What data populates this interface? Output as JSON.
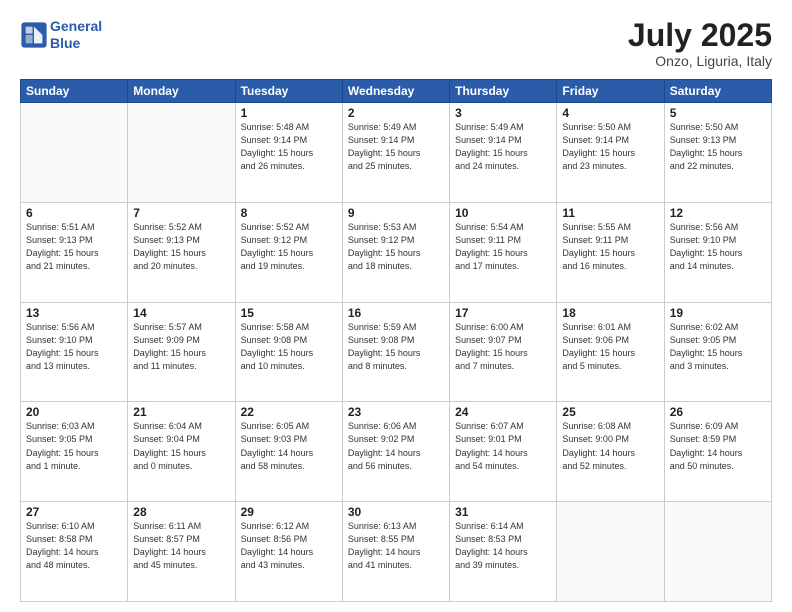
{
  "header": {
    "logo_line1": "General",
    "logo_line2": "Blue",
    "month": "July 2025",
    "location": "Onzo, Liguria, Italy"
  },
  "weekdays": [
    "Sunday",
    "Monday",
    "Tuesday",
    "Wednesday",
    "Thursday",
    "Friday",
    "Saturday"
  ],
  "weeks": [
    [
      {
        "day": "",
        "info": ""
      },
      {
        "day": "",
        "info": ""
      },
      {
        "day": "1",
        "info": "Sunrise: 5:48 AM\nSunset: 9:14 PM\nDaylight: 15 hours\nand 26 minutes."
      },
      {
        "day": "2",
        "info": "Sunrise: 5:49 AM\nSunset: 9:14 PM\nDaylight: 15 hours\nand 25 minutes."
      },
      {
        "day": "3",
        "info": "Sunrise: 5:49 AM\nSunset: 9:14 PM\nDaylight: 15 hours\nand 24 minutes."
      },
      {
        "day": "4",
        "info": "Sunrise: 5:50 AM\nSunset: 9:14 PM\nDaylight: 15 hours\nand 23 minutes."
      },
      {
        "day": "5",
        "info": "Sunrise: 5:50 AM\nSunset: 9:13 PM\nDaylight: 15 hours\nand 22 minutes."
      }
    ],
    [
      {
        "day": "6",
        "info": "Sunrise: 5:51 AM\nSunset: 9:13 PM\nDaylight: 15 hours\nand 21 minutes."
      },
      {
        "day": "7",
        "info": "Sunrise: 5:52 AM\nSunset: 9:13 PM\nDaylight: 15 hours\nand 20 minutes."
      },
      {
        "day": "8",
        "info": "Sunrise: 5:52 AM\nSunset: 9:12 PM\nDaylight: 15 hours\nand 19 minutes."
      },
      {
        "day": "9",
        "info": "Sunrise: 5:53 AM\nSunset: 9:12 PM\nDaylight: 15 hours\nand 18 minutes."
      },
      {
        "day": "10",
        "info": "Sunrise: 5:54 AM\nSunset: 9:11 PM\nDaylight: 15 hours\nand 17 minutes."
      },
      {
        "day": "11",
        "info": "Sunrise: 5:55 AM\nSunset: 9:11 PM\nDaylight: 15 hours\nand 16 minutes."
      },
      {
        "day": "12",
        "info": "Sunrise: 5:56 AM\nSunset: 9:10 PM\nDaylight: 15 hours\nand 14 minutes."
      }
    ],
    [
      {
        "day": "13",
        "info": "Sunrise: 5:56 AM\nSunset: 9:10 PM\nDaylight: 15 hours\nand 13 minutes."
      },
      {
        "day": "14",
        "info": "Sunrise: 5:57 AM\nSunset: 9:09 PM\nDaylight: 15 hours\nand 11 minutes."
      },
      {
        "day": "15",
        "info": "Sunrise: 5:58 AM\nSunset: 9:08 PM\nDaylight: 15 hours\nand 10 minutes."
      },
      {
        "day": "16",
        "info": "Sunrise: 5:59 AM\nSunset: 9:08 PM\nDaylight: 15 hours\nand 8 minutes."
      },
      {
        "day": "17",
        "info": "Sunrise: 6:00 AM\nSunset: 9:07 PM\nDaylight: 15 hours\nand 7 minutes."
      },
      {
        "day": "18",
        "info": "Sunrise: 6:01 AM\nSunset: 9:06 PM\nDaylight: 15 hours\nand 5 minutes."
      },
      {
        "day": "19",
        "info": "Sunrise: 6:02 AM\nSunset: 9:05 PM\nDaylight: 15 hours\nand 3 minutes."
      }
    ],
    [
      {
        "day": "20",
        "info": "Sunrise: 6:03 AM\nSunset: 9:05 PM\nDaylight: 15 hours\nand 1 minute."
      },
      {
        "day": "21",
        "info": "Sunrise: 6:04 AM\nSunset: 9:04 PM\nDaylight: 15 hours\nand 0 minutes."
      },
      {
        "day": "22",
        "info": "Sunrise: 6:05 AM\nSunset: 9:03 PM\nDaylight: 14 hours\nand 58 minutes."
      },
      {
        "day": "23",
        "info": "Sunrise: 6:06 AM\nSunset: 9:02 PM\nDaylight: 14 hours\nand 56 minutes."
      },
      {
        "day": "24",
        "info": "Sunrise: 6:07 AM\nSunset: 9:01 PM\nDaylight: 14 hours\nand 54 minutes."
      },
      {
        "day": "25",
        "info": "Sunrise: 6:08 AM\nSunset: 9:00 PM\nDaylight: 14 hours\nand 52 minutes."
      },
      {
        "day": "26",
        "info": "Sunrise: 6:09 AM\nSunset: 8:59 PM\nDaylight: 14 hours\nand 50 minutes."
      }
    ],
    [
      {
        "day": "27",
        "info": "Sunrise: 6:10 AM\nSunset: 8:58 PM\nDaylight: 14 hours\nand 48 minutes."
      },
      {
        "day": "28",
        "info": "Sunrise: 6:11 AM\nSunset: 8:57 PM\nDaylight: 14 hours\nand 45 minutes."
      },
      {
        "day": "29",
        "info": "Sunrise: 6:12 AM\nSunset: 8:56 PM\nDaylight: 14 hours\nand 43 minutes."
      },
      {
        "day": "30",
        "info": "Sunrise: 6:13 AM\nSunset: 8:55 PM\nDaylight: 14 hours\nand 41 minutes."
      },
      {
        "day": "31",
        "info": "Sunrise: 6:14 AM\nSunset: 8:53 PM\nDaylight: 14 hours\nand 39 minutes."
      },
      {
        "day": "",
        "info": ""
      },
      {
        "day": "",
        "info": ""
      }
    ]
  ]
}
